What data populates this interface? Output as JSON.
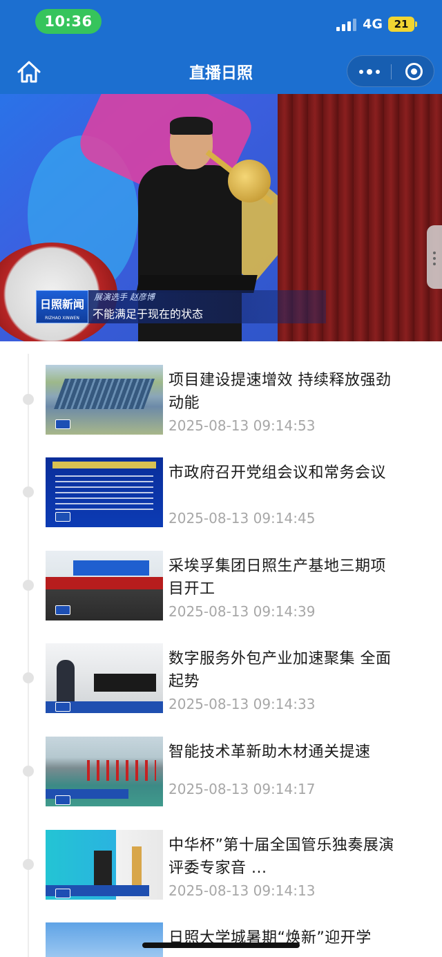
{
  "status_bar": {
    "time": "10:36",
    "network": "4G",
    "battery": "21"
  },
  "nav": {
    "title": "直播日照",
    "home_icon": "home-icon",
    "more_icon": "more-dots-icon",
    "close_icon": "target-close-icon"
  },
  "video": {
    "logo_text": "日照新闻",
    "logo_sub": "RIZHAO XINWEN",
    "caption_small": "展演选手  赵彦博",
    "caption_main": "不能满足于现在的状态"
  },
  "news": [
    {
      "title": "项目建设提速增效 持续释放强劲动能",
      "time": "2025-08-13 09:14:53",
      "thumb": "aerial-factory"
    },
    {
      "title": "市政府召开党组会议和常务会议",
      "time": "2025-08-13 09:14:45",
      "thumb": "meeting-notice"
    },
    {
      "title": "采埃孚集团日照生产基地三期项目开工",
      "time": "2025-08-13 09:14:39",
      "thumb": "groundbreaking-ceremony"
    },
    {
      "title": "数字服务外包产业加速聚集 全面起势",
      "time": "2025-08-13 09:14:33",
      "thumb": "office-workers"
    },
    {
      "title": "智能技术革新助木材通关提速",
      "time": "2025-08-13 09:14:17",
      "thumb": "port-cranes"
    },
    {
      "title": "中华杯”第十届全国管乐独奏展演评委专家音 ...",
      "time": "2025-08-13 09:14:13",
      "thumb": "concert-stage"
    },
    {
      "title": "日照大学城暑期“焕新”迎开学",
      "time": "",
      "thumb": "campus-sky"
    }
  ]
}
